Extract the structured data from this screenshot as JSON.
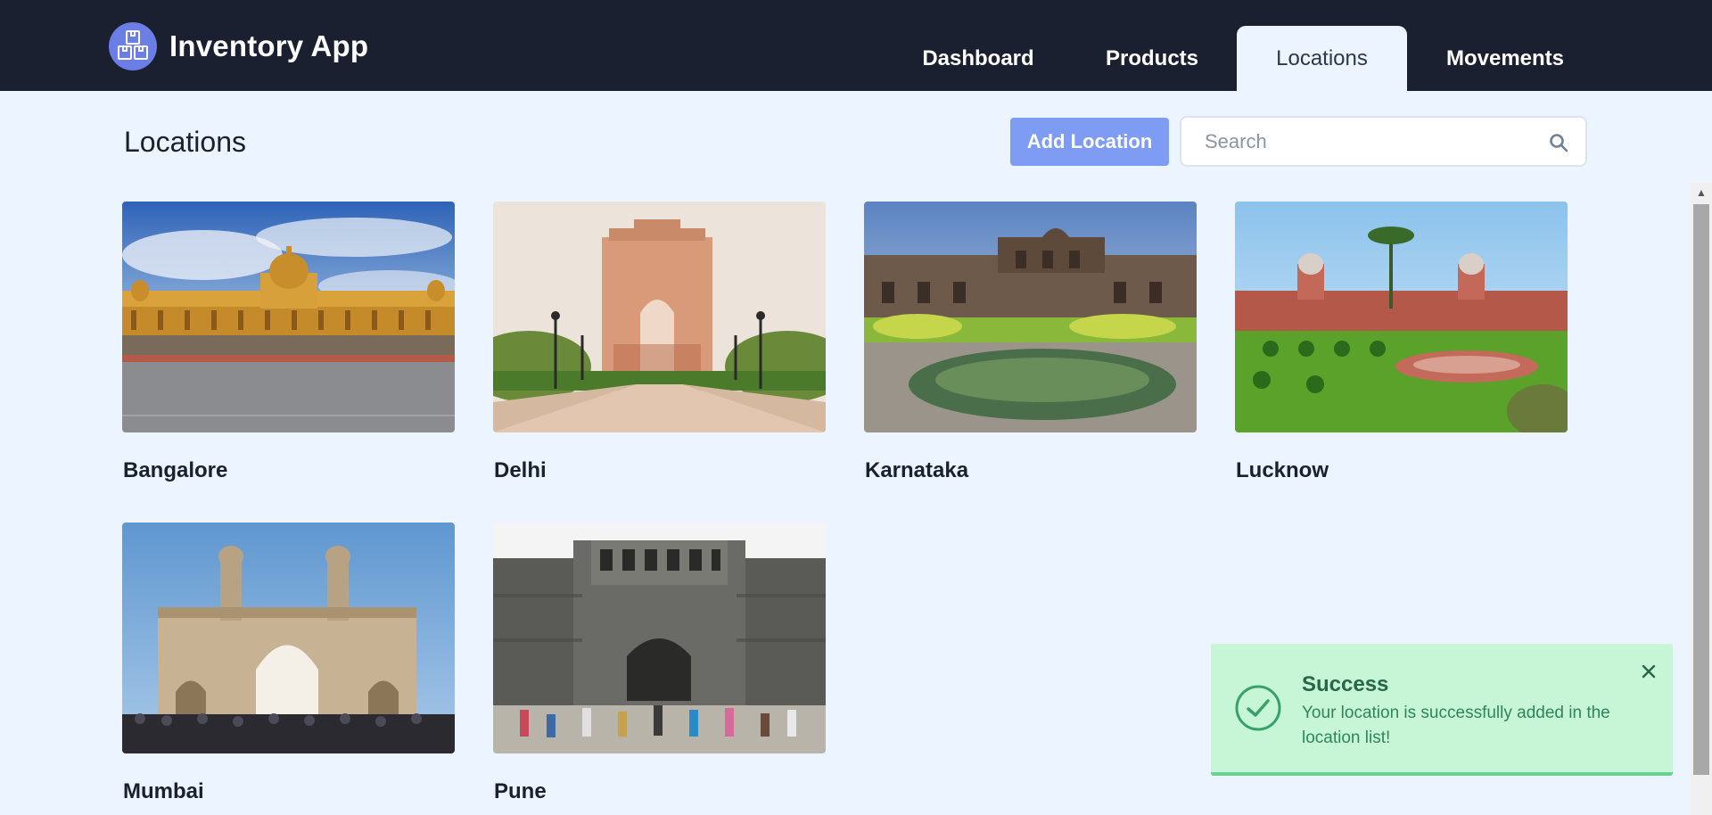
{
  "app": {
    "name": "Inventory App",
    "logo_icon": "boxes-icon"
  },
  "nav": {
    "tabs": [
      {
        "label": "Dashboard",
        "active": false
      },
      {
        "label": "Products",
        "active": false
      },
      {
        "label": "Locations",
        "active": true
      },
      {
        "label": "Movements",
        "active": false
      }
    ]
  },
  "page": {
    "title": "Locations",
    "add_button_label": "Add Location",
    "search": {
      "placeholder": "Search",
      "value": "",
      "icon": "search-icon"
    }
  },
  "locations": [
    {
      "name": "Bangalore",
      "image": "Vidhana Soudha building photo"
    },
    {
      "name": "Delhi",
      "image": "India Gate photo"
    },
    {
      "name": "Karnataka",
      "image": "historic ruins with pond photo"
    },
    {
      "name": "Lucknow",
      "image": "red palace with gardens photo"
    },
    {
      "name": "Mumbai",
      "image": "Gateway of India photo"
    },
    {
      "name": "Pune",
      "image": "Shaniwar Wada fort photo"
    }
  ],
  "toast": {
    "title": "Success",
    "message": "Your location is successfully added in the location list!",
    "icon": "check-circle-icon",
    "close_icon": "close-icon"
  },
  "colors": {
    "header_bg": "#1b2030",
    "page_bg": "#ebf4ff",
    "accent": "#7f9cf5",
    "logo_bg": "#6b7ee6",
    "toast_bg": "#c6f6d5",
    "toast_text": "#276749"
  }
}
